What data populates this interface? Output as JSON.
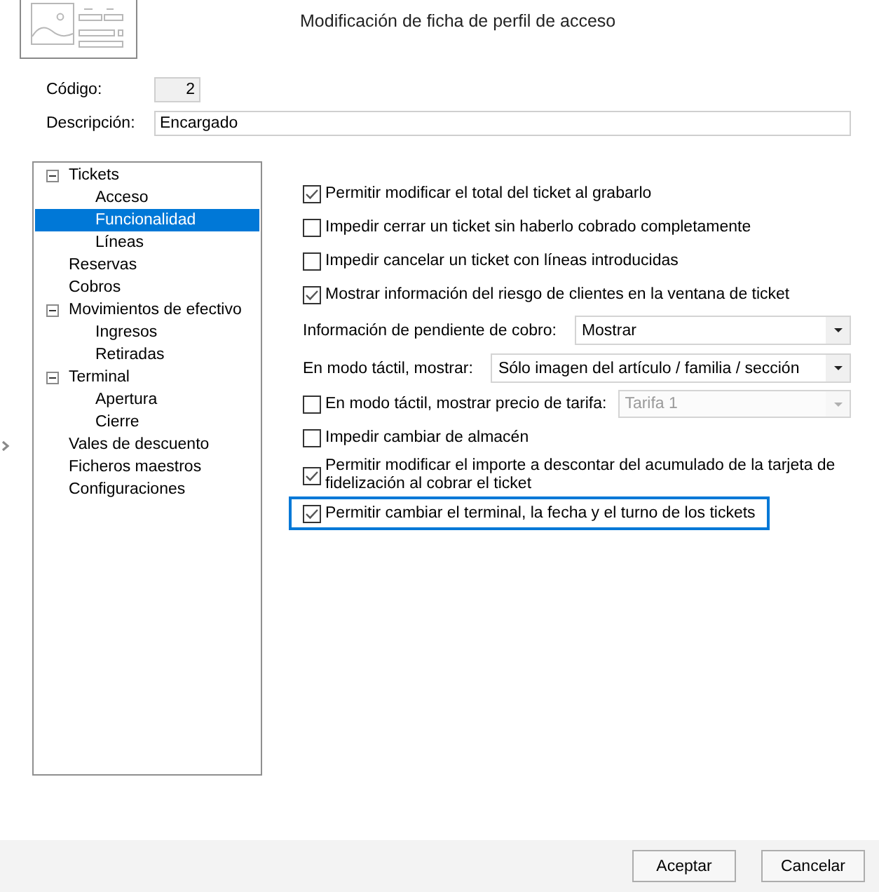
{
  "header": {
    "title": "Modificación de ficha de perfil de acceso"
  },
  "fields": [
    {
      "label": "Código:",
      "value": "2",
      "readonly": true
    },
    {
      "label": "Descripción:",
      "value": "Encargado",
      "readonly": false
    }
  ],
  "tree": [
    {
      "label": "Tickets",
      "selected": false,
      "expanded": true,
      "children": [
        {
          "label": "Acceso",
          "selected": false
        },
        {
          "label": "Funcionalidad",
          "selected": true
        },
        {
          "label": "Líneas",
          "selected": false
        }
      ]
    },
    {
      "label": "Reservas",
      "selected": false
    },
    {
      "label": "Cobros",
      "selected": false
    },
    {
      "label": "Movimientos de efectivo",
      "selected": false,
      "expanded": true,
      "children": [
        {
          "label": "Ingresos",
          "selected": false
        },
        {
          "label": "Retiradas",
          "selected": false
        }
      ]
    },
    {
      "label": "Terminal",
      "selected": false,
      "expanded": true,
      "children": [
        {
          "label": "Apertura",
          "selected": false
        },
        {
          "label": "Cierre",
          "selected": false
        }
      ]
    },
    {
      "label": "Vales de descuento",
      "selected": false
    },
    {
      "label": "Ficheros maestros",
      "selected": false
    },
    {
      "label": "Configuraciones",
      "selected": false
    }
  ],
  "options": [
    {
      "kind": "checkbox",
      "label": "Permitir modificar el total del ticket al grabarlo",
      "checked": true,
      "focused": false,
      "disabled": false
    },
    {
      "kind": "checkbox",
      "label": "Impedir cerrar un ticket sin haberlo cobrado completamente",
      "checked": false,
      "focused": false,
      "disabled": false
    },
    {
      "kind": "checkbox",
      "label": "Impedir cancelar un ticket con líneas introducidas",
      "checked": false,
      "focused": false,
      "disabled": false
    },
    {
      "kind": "checkbox",
      "label": "Mostrar información del riesgo de clientes en la ventana de ticket",
      "checked": true,
      "focused": false,
      "disabled": false
    },
    {
      "kind": "dropdown",
      "label": "Información de pendiente de cobro:",
      "value": "Mostrar",
      "disabled": false
    },
    {
      "kind": "dropdown",
      "label": "En modo táctil, mostrar:",
      "value": "Sólo imagen del artículo / familia / sección",
      "disabled": false
    },
    {
      "kind": "checkbox_dropdown",
      "label": "En modo táctil, mostrar precio de tarifa:",
      "checked": false,
      "focused": false,
      "value": "Tarifa 1",
      "disabled": true
    },
    {
      "kind": "checkbox",
      "label": "Impedir cambiar de almacén",
      "checked": false,
      "focused": false,
      "disabled": false
    },
    {
      "kind": "checkbox",
      "label": "Permitir modificar el importe a descontar del acumulado de la tarjeta de fidelización al cobrar el ticket",
      "checked": true,
      "focused": false,
      "disabled": false
    },
    {
      "kind": "checkbox",
      "label": "Permitir cambiar el terminal, la fecha y el turno de los tickets",
      "checked": true,
      "focused": true,
      "disabled": false
    }
  ],
  "buttons": [
    {
      "label": "Aceptar"
    },
    {
      "label": "Cancelar"
    }
  ]
}
